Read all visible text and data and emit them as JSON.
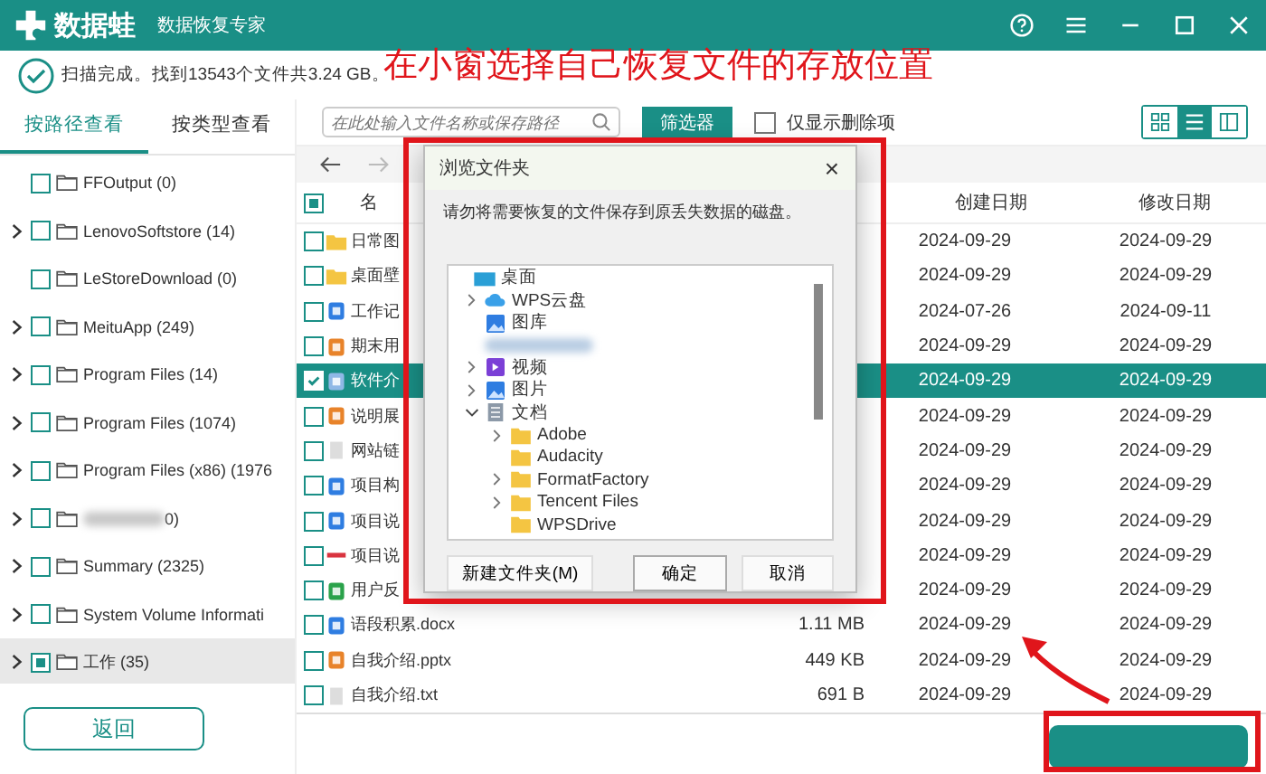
{
  "app": {
    "logo": "数据蛙",
    "subtitle": "数据恢复专家"
  },
  "status": "扫描完成。找到13543个文件共3.24 GB。",
  "annotation": "在小窗选择自己恢复文件的存放位置",
  "tabs": [
    {
      "label": "按路径查看",
      "selected": true
    },
    {
      "label": "按类型查看",
      "selected": false
    }
  ],
  "tree": [
    {
      "label": "FFOutput (0)",
      "expandable": false,
      "checked": false,
      "selected": false,
      "blurred": false
    },
    {
      "label": "LenovoSoftstore (14)",
      "expandable": true,
      "checked": false,
      "selected": false,
      "blurred": false
    },
    {
      "label": "LeStoreDownload (0)",
      "expandable": false,
      "checked": false,
      "selected": false,
      "blurred": false
    },
    {
      "label": "MeituApp (249)",
      "expandable": true,
      "checked": false,
      "selected": false,
      "blurred": false
    },
    {
      "label": "Program Files (14)",
      "expandable": true,
      "checked": false,
      "selected": false,
      "blurred": false
    },
    {
      "label": "Program Files (1074)",
      "expandable": true,
      "checked": false,
      "selected": false,
      "blurred": false
    },
    {
      "label": "Program Files (x86) (1976",
      "expandable": true,
      "checked": false,
      "selected": false,
      "blurred": false
    },
    {
      "label": "0)",
      "expandable": true,
      "checked": false,
      "selected": false,
      "blurred": true
    },
    {
      "label": "Summary (2325)",
      "expandable": true,
      "checked": false,
      "selected": false,
      "blurred": false
    },
    {
      "label": "System Volume Informati",
      "expandable": true,
      "checked": false,
      "selected": false,
      "blurred": false
    },
    {
      "label": "工作 (35)",
      "expandable": true,
      "checked": true,
      "selected": true,
      "blurred": false
    }
  ],
  "back_button": "返回",
  "search": {
    "placeholder": "在此处输入文件名称或保存路径"
  },
  "filter_button": "筛选器",
  "deleted_only": {
    "label": "仅显示删除项",
    "checked": false
  },
  "views": [
    {
      "kind": "grid",
      "selected": false
    },
    {
      "kind": "list",
      "selected": true
    },
    {
      "kind": "columns",
      "selected": false
    }
  ],
  "table": {
    "header_checked": true,
    "columns": [
      "名",
      "创建日期",
      "修改日期"
    ],
    "rows": [
      {
        "kind": "folder",
        "name": "日常图",
        "created": "2024-09-29",
        "modified": "2024-09-29",
        "selected": false
      },
      {
        "kind": "folder",
        "name": "桌面壁",
        "created": "2024-09-29",
        "modified": "2024-09-29",
        "selected": false
      },
      {
        "kind": "word",
        "name": "工作记",
        "created": "2024-07-26",
        "modified": "2024-09-11",
        "selected": false
      },
      {
        "kind": "ppt",
        "name": "期末用",
        "created": "2024-09-29",
        "modified": "2024-09-29",
        "selected": false
      },
      {
        "kind": "doc",
        "name": "软件介",
        "created": "2024-09-29",
        "modified": "2024-09-29",
        "selected": true
      },
      {
        "kind": "ppt",
        "name": "说明展",
        "created": "2024-09-29",
        "modified": "2024-09-29",
        "selected": false
      },
      {
        "kind": "txt",
        "name": "网站链",
        "created": "2024-09-29",
        "modified": "2024-09-29",
        "selected": false
      },
      {
        "kind": "word",
        "name": "项目构",
        "created": "2024-09-29",
        "modified": "2024-09-29",
        "selected": false
      },
      {
        "kind": "word",
        "name": "项目说",
        "created": "2024-09-29",
        "modified": "2024-09-29",
        "selected": false
      },
      {
        "kind": "pdf",
        "name": "项目说",
        "created": "2024-09-29",
        "modified": "2024-09-29",
        "selected": false
      },
      {
        "kind": "excel",
        "name": "用户反",
        "created": "2024-09-29",
        "modified": "2024-09-29",
        "selected": false
      },
      {
        "kind": "word",
        "name": "语段积累.docx",
        "size": "1.11 MB",
        "created": "2024-09-29",
        "modified": "2024-09-29",
        "selected": false
      },
      {
        "kind": "ppt",
        "name": "自我介绍.pptx",
        "size": "449 KB",
        "created": "2024-09-29",
        "modified": "2024-09-29",
        "selected": false
      },
      {
        "kind": "txt",
        "name": "自我介绍.txt",
        "size": "691 B",
        "created": "2024-09-29",
        "modified": "2024-09-29",
        "selected": false
      }
    ]
  },
  "dialog": {
    "title": "浏览文件夹",
    "close": "×",
    "message": "请勿将需要恢复的文件保存到原丢失数据的磁盘。",
    "tree": [
      {
        "label": "桌面",
        "kind": "desktop",
        "expandable": false,
        "blurred": false,
        "children": [
          {
            "label": "WPS云盘",
            "kind": "cloud",
            "expandable": true,
            "blurred": false
          },
          {
            "label": "图库",
            "kind": "gallery",
            "expandable": false,
            "blurred": false
          },
          {
            "expandable": false,
            "blurred": true
          },
          {
            "label": "视频",
            "kind": "video",
            "expandable": true,
            "blurred": false
          },
          {
            "label": "图片",
            "kind": "gallery",
            "expandable": true,
            "blurred": false
          },
          {
            "label": "文档",
            "kind": "docs",
            "expandable": true,
            "expanded": true,
            "blurred": false,
            "children": [
              {
                "label": "Adobe",
                "kind": "folder",
                "expandable": true,
                "blurred": false
              },
              {
                "label": "Audacity",
                "kind": "folder",
                "expandable": false,
                "blurred": false
              },
              {
                "label": "FormatFactory",
                "kind": "folder",
                "expandable": true,
                "blurred": false
              },
              {
                "label": "Tencent Files",
                "kind": "folder",
                "expandable": true,
                "blurred": false
              },
              {
                "label": "WPSDrive",
                "kind": "folder",
                "expandable": false,
                "blurred": false
              }
            ]
          }
        ]
      }
    ],
    "buttons": [
      "新建文件夹(M)",
      "确定",
      "取消"
    ]
  }
}
